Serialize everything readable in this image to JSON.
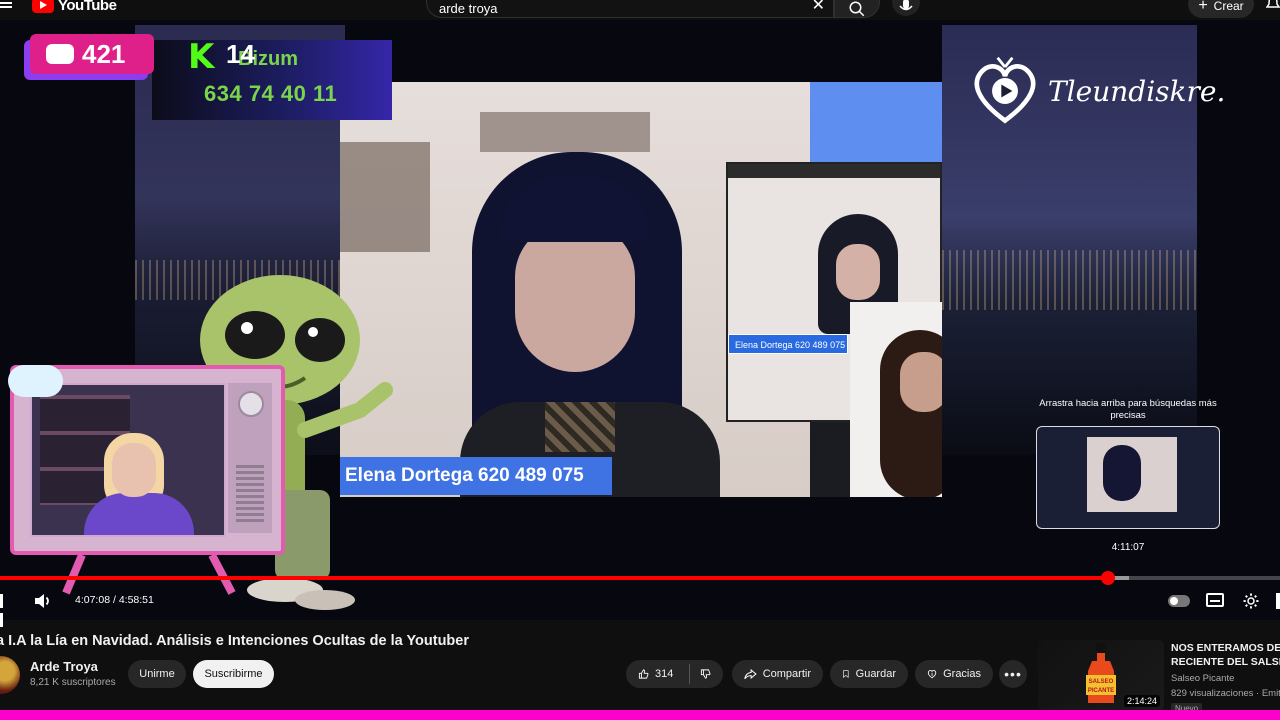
{
  "header": {
    "logo_text": "YouTube",
    "search_query": "arde troya",
    "create_label": "Crear"
  },
  "stream_overlay": {
    "yt_viewers": "421",
    "kick_viewers": "14",
    "bizum_label": "Bizum",
    "bizum_phone": "634 74 40 11",
    "brand_text": "Tleundiskre.",
    "guest_banner": "Elena Dortega 620 489 075",
    "inset_banner": "Elena Dortega 620 489 075"
  },
  "player": {
    "current_time": "4:07:08",
    "duration": "4:58:51",
    "progress_fraction": 0.866,
    "buffer_fraction": 0.882,
    "drag_hint": "Arrastra hacia arriba para búsquedas más precisas",
    "preview_time": "4:11:07"
  },
  "video": {
    "title": "a I.A la Lía en Navidad. Análisis e Intenciones Ocultas de la Youtuber",
    "channel_name": "Arde Troya",
    "subscribers": "8,21 K suscriptores",
    "join_label": "Unirme",
    "subscribe_label": "Suscribirme",
    "likes": "314",
    "share_label": "Compartir",
    "save_label": "Guardar",
    "thanks_label": "Gracias"
  },
  "recommendation": {
    "title_line1": "NOS ENTERAMOS DE L",
    "title_line2": "RECIENTE DEL SALSE",
    "channel": "Salseo Picante",
    "views": "829 visualizaciones · Emiti",
    "duration": "2:14:24",
    "badge": "Nuevo",
    "thumb_text1": "SALSEO",
    "thumb_text2": "PICANTE"
  },
  "colors": {
    "accent_red": "#ff0000",
    "overlay_pink": "#e0208a",
    "kick_green": "#53fc18",
    "banner_blue": "#3f73e4"
  }
}
